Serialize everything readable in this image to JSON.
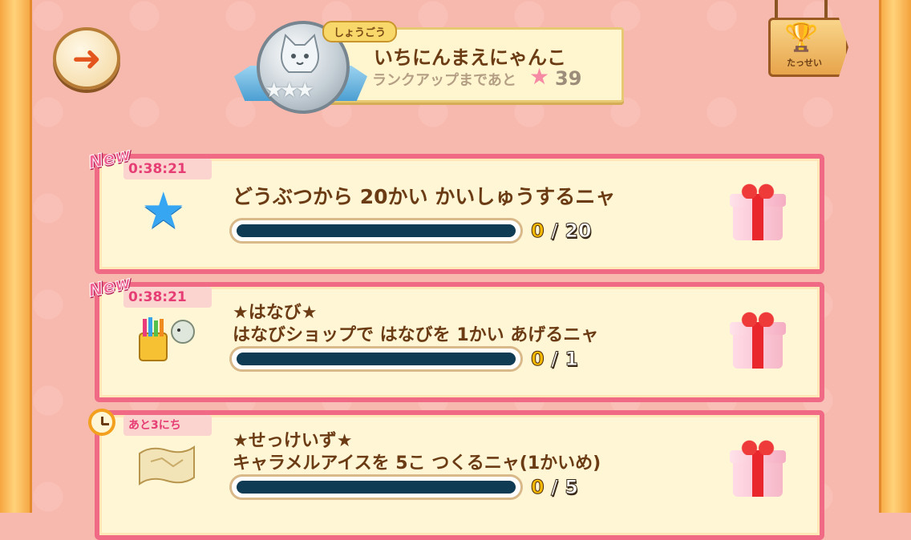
{
  "header": {
    "back_icon": "back-arrow-icon",
    "rank": {
      "tag": "しょうごう",
      "title": "いちにんまえにゃんこ",
      "rankup_text": "ランクアップまであと",
      "rankup_count": "39",
      "medal_stars": "★★★"
    },
    "achievement": {
      "label": "たっせい",
      "icon": "trophy-icon"
    }
  },
  "missions": [
    {
      "badge": "New",
      "timer": "0:38:21",
      "title_lines": [
        "どうぶつから 20かい かいしゅうするニャ"
      ],
      "current": "0",
      "separator": "/",
      "total": "20",
      "progress": 0,
      "icon": "star-icon"
    },
    {
      "badge": "New",
      "timer": "0:38:21",
      "title_lines": [
        "★はなび★",
        "はなびショップで  はなびを 1かい あげるニャ"
      ],
      "current": "0",
      "separator": "/",
      "total": "1",
      "progress": 0,
      "icon": "fireworks-icon"
    },
    {
      "badge": "",
      "timer": "あと3にち",
      "title_lines": [
        "★せっけいず★",
        "キャラメルアイスを 5こ つくるニャ(1かいめ)"
      ],
      "current": "0",
      "separator": "/",
      "total": "5",
      "progress": 0,
      "icon": "blueprint-icon"
    }
  ],
  "colors": {
    "background": "#f7b9ae",
    "card_border": "#f06a86",
    "card_fill": "#fff6d6",
    "bar_track": "#0f3b54",
    "text_brown": "#6b3b14",
    "timer_pink": "#e63d74"
  }
}
